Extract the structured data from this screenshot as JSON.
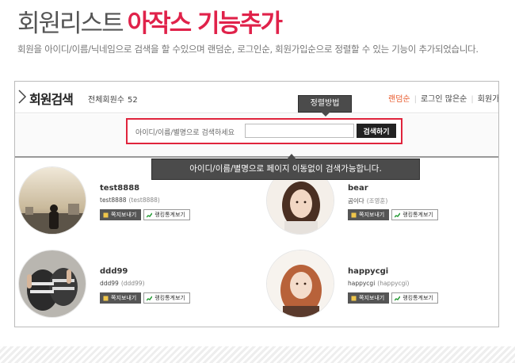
{
  "hero": {
    "title_plain": "회원리스트",
    "title_accent": "아작스 기능추가",
    "description": "회원을 아이디/이름/닉네임으로 검색을 할 수있으며 랜덤순, 로그인순, 회원가입순으로 정렬할 수 있는 기능이 추가되었습니다."
  },
  "panel": {
    "title": "회원검색",
    "member_count_label": "전체회원수",
    "member_count": "52",
    "sort_links": [
      {
        "label": "랜덤순",
        "active": true
      },
      {
        "label": "로그인 많은순",
        "active": false
      },
      {
        "label": "회원가입순",
        "active": false
      }
    ],
    "search": {
      "label": "아이디/이름/별명으로 검색하세요",
      "value": "",
      "placeholder": "",
      "button": "검색하기"
    }
  },
  "members": [
    {
      "name": "test8888",
      "id": "test8888",
      "real_name": "(test8888)",
      "msg_button": "쪽지보내기",
      "rank_button": "랭킹통계보기",
      "avatar": "silhouette-city-photo"
    },
    {
      "name": "bear",
      "id": "곰이다",
      "real_name": "(조영훈)",
      "msg_button": "쪽지보내기",
      "rank_button": "랭킹통계보기",
      "avatar": "woman-portrait-photo"
    },
    {
      "name": "ddd99",
      "id": "ddd99",
      "real_name": "(ddd99)",
      "msg_button": "쪽지보내기",
      "rank_button": "랭킹통계보기",
      "avatar": "gloved-hands-photo"
    },
    {
      "name": "happycgi",
      "id": "happycgi",
      "real_name": "(happycgi)",
      "msg_button": "쪽지보내기",
      "rank_button": "랭킹통계보기",
      "avatar": "red-hair-woman-photo"
    }
  ],
  "tooltips": {
    "sort": "정렬방법",
    "search": "아이디/이름/별명으로 페이지 이동없이 검색가능합니다."
  },
  "colors": {
    "accent": "#e0224a",
    "active_sort": "#e85a2c",
    "highlight_border": "#e0243c",
    "tooltip_bg": "#4b4b4b"
  }
}
